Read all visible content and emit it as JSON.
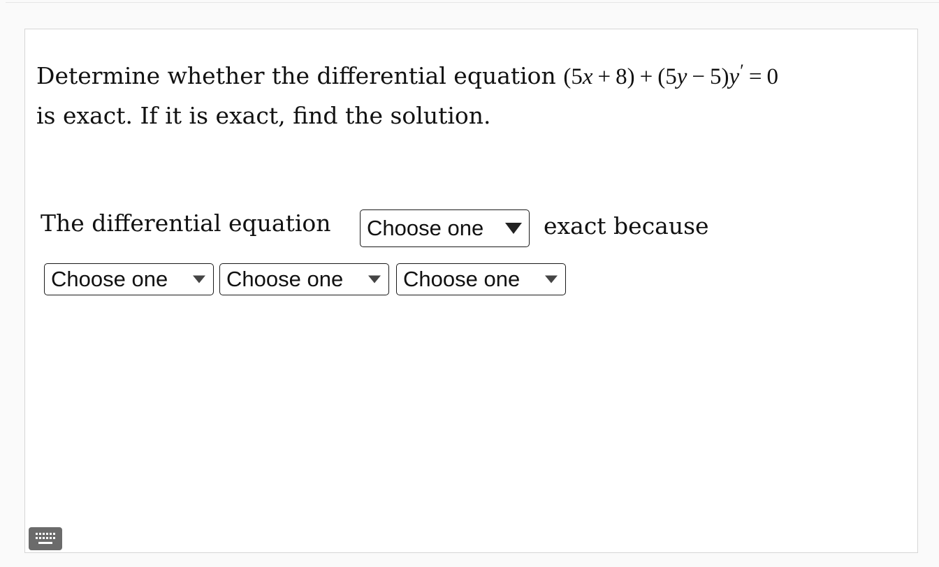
{
  "question": {
    "text_before": "Determine whether the differential equation",
    "equation": {
      "open1": "(",
      "c1": "5",
      "v1": "x",
      "op1": "+",
      "c2": "8",
      "close1": ")",
      "op2": "+",
      "open2": "(",
      "c3": "5",
      "v2": "y",
      "op3": "−",
      "c4": "5",
      "close2": ")",
      "v3": "y",
      "prime": "′",
      "eq": "=",
      "rhs": "0"
    },
    "text_after": "is exact. If it is exact, find the solution."
  },
  "answer": {
    "prefix": "The differential equation",
    "main_select": "Choose one",
    "suffix": "exact because",
    "reason_selects": [
      "Choose one",
      "Choose one",
      "Choose one"
    ]
  },
  "icons": {
    "keyboard": "keyboard-icon",
    "dropdown": "triangle-down-icon"
  },
  "colors": {
    "border": "#1a1a1a",
    "keyboard_button": "#6b6b6b",
    "card_border": "#d6d6d6"
  }
}
